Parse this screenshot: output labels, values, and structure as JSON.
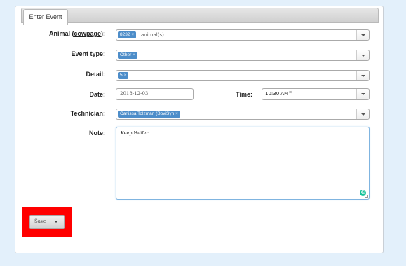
{
  "tabs": [
    {
      "label": "Enter Event"
    }
  ],
  "form": {
    "animal": {
      "label_prefix": "Animal (",
      "label_link": "cowpage",
      "label_suffix": "):",
      "chip": "8232",
      "chip_remove": "×",
      "suffix_text": "animal(s)"
    },
    "event_type": {
      "label": "Event type:",
      "chip": "Other",
      "chip_remove": "×"
    },
    "detail": {
      "label": "Detail:",
      "chip": "5",
      "chip_remove": "×"
    },
    "date": {
      "label": "Date:",
      "value": "2018-12-03"
    },
    "time": {
      "label": "Time:",
      "value": "10:30 AM",
      "clear": "×"
    },
    "technician": {
      "label": "Technician:",
      "chip": "Carlissa Tolzman (BoviSyn",
      "chip_remove": "×"
    },
    "note": {
      "label": "Note:",
      "value": "Keep Heifer|"
    }
  },
  "actions": {
    "save_label": "Save"
  },
  "colors": {
    "chip": "#4d8dc9",
    "highlight": "#ff0000",
    "background": "#e3f0fb"
  }
}
